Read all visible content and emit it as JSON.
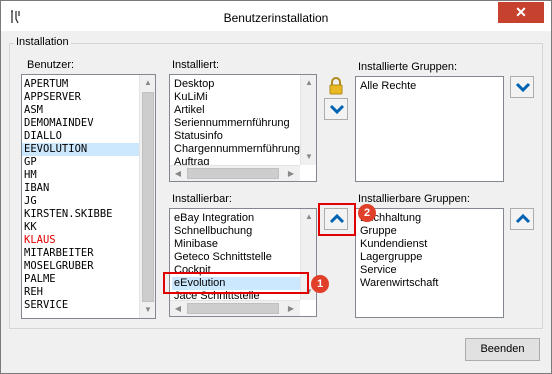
{
  "window": {
    "title": "Benutzerinstallation",
    "close_glyph": "✕"
  },
  "group": {
    "label": "Installation"
  },
  "users": {
    "label": "Benutzer:",
    "items": [
      "APERTUM",
      "APPSERVER",
      "ASM",
      "DEMOMAINDEV",
      "DIALLO",
      "EEVOLUTION",
      "GP",
      "HM",
      "IBAN",
      "JG",
      "KIRSTEN.SKIBBE",
      "KK",
      "KLAUS",
      "MITARBEITER",
      "MOSELGRUBER",
      "PALME",
      "REH",
      "SERVICE"
    ],
    "selected": "EEVOLUTION",
    "highlight_red": "KLAUS"
  },
  "installed": {
    "label": "Installiert:",
    "items": [
      "Desktop",
      "KuLiMi",
      "Artikel",
      "Seriennummernführung",
      "Statusinfo",
      "Chargennummernführung",
      "Auftrag"
    ]
  },
  "installable": {
    "label": "Installierbar:",
    "items": [
      "eBay Integration",
      "Schnellbuchung",
      "Minibase",
      "Geteco Schnittstelle",
      "Cockpit",
      "eEvolution",
      "Jace Schnittstelle"
    ],
    "selected": "eEvolution"
  },
  "installed_groups": {
    "label": "Installierte Gruppen:",
    "items": [
      "Alle Rechte"
    ]
  },
  "installable_groups": {
    "label": "Installierbare Gruppen:",
    "items": [
      "Buchhaltung",
      "Gruppe",
      "Kundendienst",
      "Lagergruppe",
      "Service",
      "Warenwirtschaft"
    ]
  },
  "buttons": {
    "close_label": "Beenden"
  },
  "annotations": {
    "badge1": "1",
    "badge2": "2"
  },
  "colors": {
    "accent": "#0063b1",
    "selection": "#cce8ff",
    "callout": "#e00000",
    "close": "#c7412f"
  }
}
